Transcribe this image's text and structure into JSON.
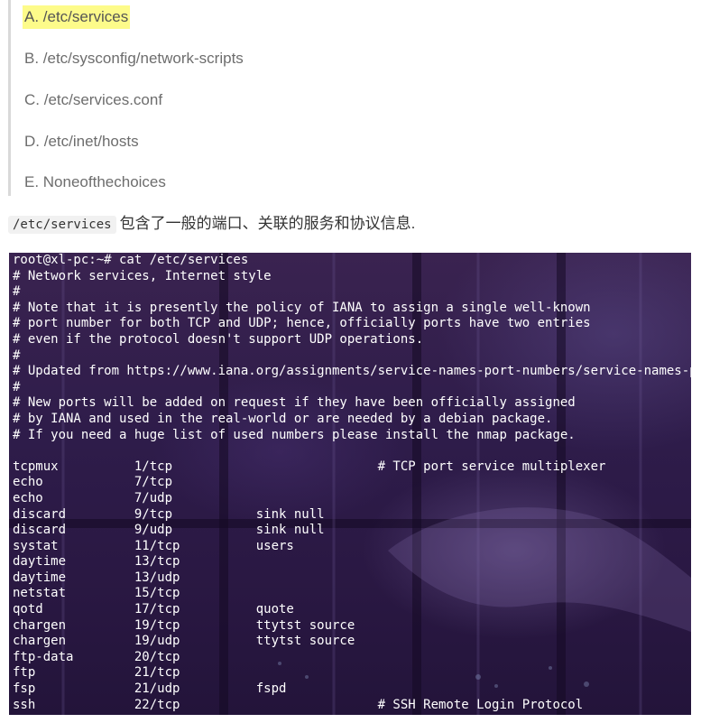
{
  "choices": [
    "A. /etc/services",
    "B. /etc/sysconfig/network-scripts",
    "C. /etc/services.conf",
    "D. /etc/inet/hosts",
    "E. Noneofthechoices"
  ],
  "explanation": {
    "code": "/etc/services",
    "text": "包含了一般的端口、关联的服务和协议信息."
  },
  "terminal": {
    "lines": [
      "root@xl-pc:~# cat /etc/services",
      "# Network services, Internet style",
      "#",
      "# Note that it is presently the policy of IANA to assign a single well-known",
      "# port number for both TCP and UDP; hence, officially ports have two entries",
      "# even if the protocol doesn't support UDP operations.",
      "#",
      "# Updated from https://www.iana.org/assignments/service-names-port-numbers/service-names-port-numbers.xhtml .",
      "#",
      "# New ports will be added on request if they have been officially assigned",
      "# by IANA and used in the real-world or are needed by a debian package.",
      "# If you need a huge list of used numbers please install the nmap package.",
      "",
      "tcpmux          1/tcp                           # TCP port service multiplexer",
      "echo            7/tcp",
      "echo            7/udp",
      "discard         9/tcp           sink null",
      "discard         9/udp           sink null",
      "systat          11/tcp          users",
      "daytime         13/tcp",
      "daytime         13/udp",
      "netstat         15/tcp",
      "qotd            17/tcp          quote",
      "chargen         19/tcp          ttytst source",
      "chargen         19/udp          ttytst source",
      "ftp-data        20/tcp",
      "ftp             21/tcp",
      "fsp             21/udp          fspd",
      "ssh             22/tcp                          # SSH Remote Login Protocol"
    ]
  },
  "colors": {
    "highlight": "#fdfb8a",
    "terminal_bg": "#2e1c4a",
    "terminal_text": "#ffffff"
  }
}
